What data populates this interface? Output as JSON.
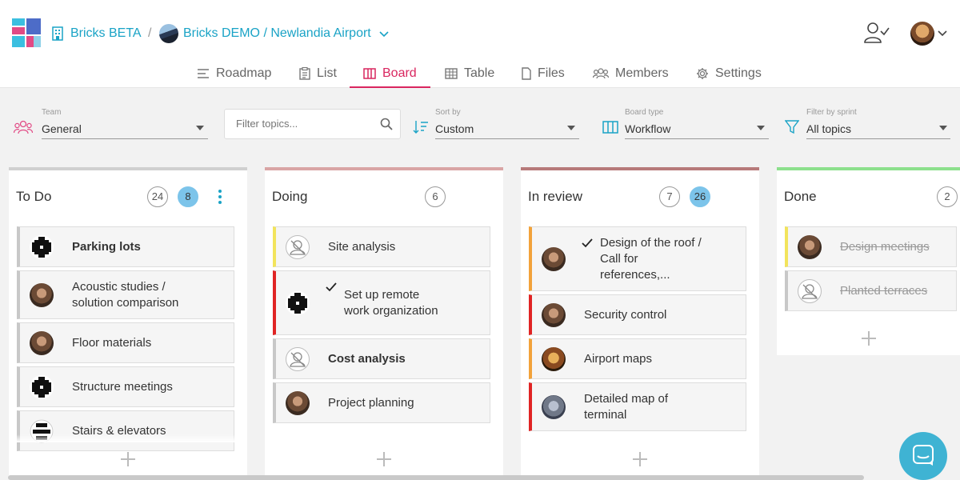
{
  "header": {
    "org": "Bricks BETA",
    "separator": "/",
    "project": "Bricks DEMO / Newlandia Airport"
  },
  "tabs": [
    {
      "label": "Roadmap",
      "icon": "roadmap-icon"
    },
    {
      "label": "List",
      "icon": "list-icon"
    },
    {
      "label": "Board",
      "icon": "board-icon",
      "active": true
    },
    {
      "label": "Table",
      "icon": "table-icon"
    },
    {
      "label": "Files",
      "icon": "file-icon"
    },
    {
      "label": "Members",
      "icon": "members-icon"
    },
    {
      "label": "Settings",
      "icon": "gear-icon"
    }
  ],
  "filters": {
    "team": {
      "label": "Team",
      "value": "General"
    },
    "search": {
      "placeholder": "Filter topics..."
    },
    "sort": {
      "label": "Sort by",
      "value": "Custom"
    },
    "board_type": {
      "label": "Board type",
      "value": "Workflow"
    },
    "sprint": {
      "label": "Filter by sprint",
      "value": "All topics"
    }
  },
  "colors": {
    "accent": "#d9265f",
    "link": "#1aa3c6",
    "todo_bar": "#d0d0d0",
    "doing_bar": "#d9a5a5",
    "review_bar": "#b77a7a",
    "done_bar": "#8de08d",
    "yellow": "#f2e45c",
    "red": "#e02424",
    "orange": "#f2a23a",
    "grey": "#c8c8c8"
  },
  "columns": [
    {
      "title": "To Do",
      "count": "24",
      "count2": "8",
      "cards": [
        {
          "text": "Parking lots",
          "bold": true,
          "avatar": "block",
          "flag": "grey"
        },
        {
          "text": "Acoustic studies / solution comparison",
          "avatar": "photo",
          "flag": "grey"
        },
        {
          "text": "Floor materials",
          "avatar": "photo",
          "flag": "grey"
        },
        {
          "text": "Structure meetings",
          "avatar": "block",
          "flag": "grey"
        },
        {
          "text": "Stairs & elevators",
          "avatar": "block2",
          "flag": "grey"
        }
      ]
    },
    {
      "title": "Doing",
      "count": "6",
      "cards": [
        {
          "text": "Site analysis",
          "avatar": "none",
          "flag": "yellow"
        },
        {
          "text": "Set up remote work organization",
          "avatar": "block",
          "flag": "red",
          "checked": true
        },
        {
          "text": "Cost analysis",
          "bold": true,
          "avatar": "none",
          "flag": "grey"
        },
        {
          "text": "Project planning",
          "avatar": "photo",
          "flag": "grey"
        }
      ]
    },
    {
      "title": "In review",
      "count": "7",
      "count2": "26",
      "cards": [
        {
          "text": "Design of the roof / Call for references,...",
          "avatar": "photo",
          "flag": "orange",
          "checked": true
        },
        {
          "text": "Security control",
          "avatar": "photo",
          "flag": "red"
        },
        {
          "text": "Airport maps",
          "avatar": "photo2",
          "flag": "orange"
        },
        {
          "text": "Detailed map of terminal",
          "avatar": "photo3",
          "flag": "red"
        }
      ]
    },
    {
      "title": "Done",
      "count": "2",
      "cards": [
        {
          "text": "Design meetings",
          "avatar": "photo",
          "flag": "yellow",
          "strike": true
        },
        {
          "text": "Planted terraces",
          "avatar": "none",
          "flag": "grey",
          "strike": true
        }
      ]
    }
  ]
}
